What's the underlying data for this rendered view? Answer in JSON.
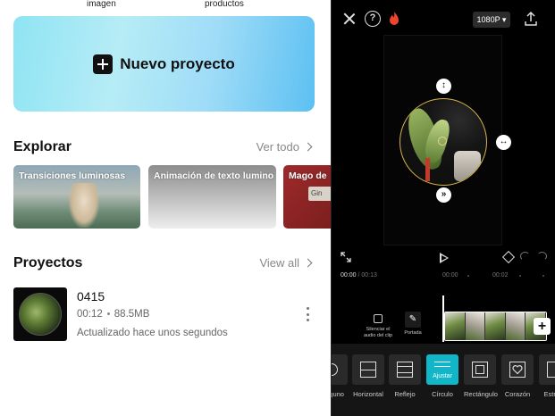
{
  "home": {
    "top_labels": [
      "imagen",
      "productos"
    ],
    "new_project": {
      "label": "Nuevo proyecto"
    },
    "explore": {
      "title": "Explorar",
      "see_all": "Ver todo",
      "cards": [
        {
          "title": "Transiciones luminosas"
        },
        {
          "title": "Animación de texto lumino"
        },
        {
          "title": "Mago de",
          "sign_text": "Gin"
        }
      ]
    },
    "projects": {
      "title": "Proyectos",
      "view_all": "View all",
      "items": [
        {
          "name": "0415",
          "duration": "00:12",
          "size": "88.5MB",
          "updated": "Actualizado hace unos segundos"
        }
      ]
    }
  },
  "editor": {
    "resolution": "1080P",
    "timecode": {
      "current": "00:00",
      "separator": "/",
      "total": "00:13"
    },
    "ruler": [
      "00:00",
      "00:02"
    ],
    "tools": {
      "mute": "Silenciar el audio del clip",
      "cover": "Portada"
    },
    "masks": [
      {
        "label": "Ninguno",
        "icon": "none-icon"
      },
      {
        "label": "Horizontal",
        "icon": "horizontal-mask-icon"
      },
      {
        "label": "Reflejo",
        "icon": "mirror-mask-icon"
      },
      {
        "label": "Círculo",
        "icon": "adjust-icon",
        "active": true,
        "active_label": "Ajustar"
      },
      {
        "label": "Rectángulo",
        "icon": "rectangle-mask-icon"
      },
      {
        "label": "Corazón",
        "icon": "heart-mask-icon"
      },
      {
        "label": "Estrella",
        "icon": "star-mask-icon"
      }
    ],
    "accent_color": "#11b7c9"
  }
}
